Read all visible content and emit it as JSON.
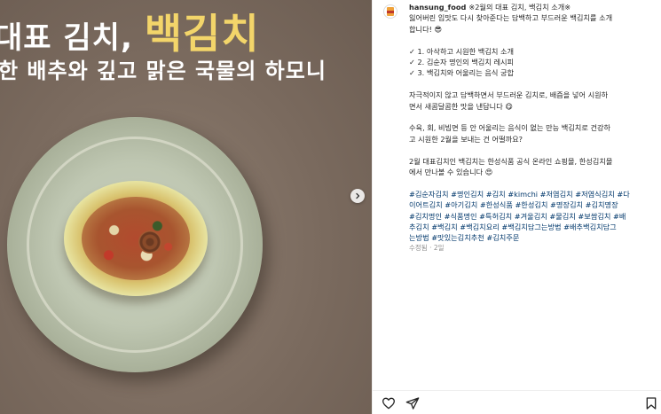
{
  "post_image": {
    "headline_prefix": "대표 김치,",
    "headline_accent": "백김치",
    "subline": "한 배추와 깊고 맑은 국물의 하모니"
  },
  "post": {
    "username": "hansung_food",
    "caption_first": "※2월의 대표 김치, 백김치 소개※",
    "caption_lines": [
      "잃어버린 입맛도 다시 찾아준다는 담백하고 부드러운 백김치를 소개",
      "합니다! 😎"
    ],
    "list_items": [
      "✓ 1. 아삭하고 시원한 백김치 소개",
      "✓ 2. 김순자 명인의 백김치 레시피",
      "✓ 3. 백김치와 어울리는 음식 궁합"
    ],
    "para1": [
      "자극적이지 않고 담백하면서 부드러운 김치로, 배즙을 넣어 시원하",
      "면서 새콤달콤한 맛을 낸답니다 😋"
    ],
    "para2": [
      "수육, 회, 비빔면 등 안 어울리는 음식이 없는 만능 백김치로 건강하",
      "고 시원한 2월을 보내는 건 어떨까요?"
    ],
    "para3": [
      "2월 대표김치인 백김치는 한성식품 공식 온라인 쇼핑몰, 한성김치몰",
      "에서 만나볼 수 있습니다 😍"
    ],
    "hashtags": [
      "#김순자김치 #명인김치 #김치 #kimchi #저염김치 #저염식김치 #다",
      "이어트김치 #아기김치 #한성식품 #한성김치 #명장김치 #김치명장",
      "#김치명인 #식품명인 #특허김치 #겨울김치 #물김치 #보쌈김치 #배",
      "추김치 #백김치 #백김치요리 #백김치담그는방법 #배추백김치담그",
      "는방법 #맛있는김치추천 #김치주문"
    ],
    "posted_label": "수정됨 · 2일"
  },
  "icons": {
    "next": "chevron-right-icon",
    "like": "heart-icon",
    "share": "paper-plane-icon",
    "save": "bookmark-icon"
  }
}
